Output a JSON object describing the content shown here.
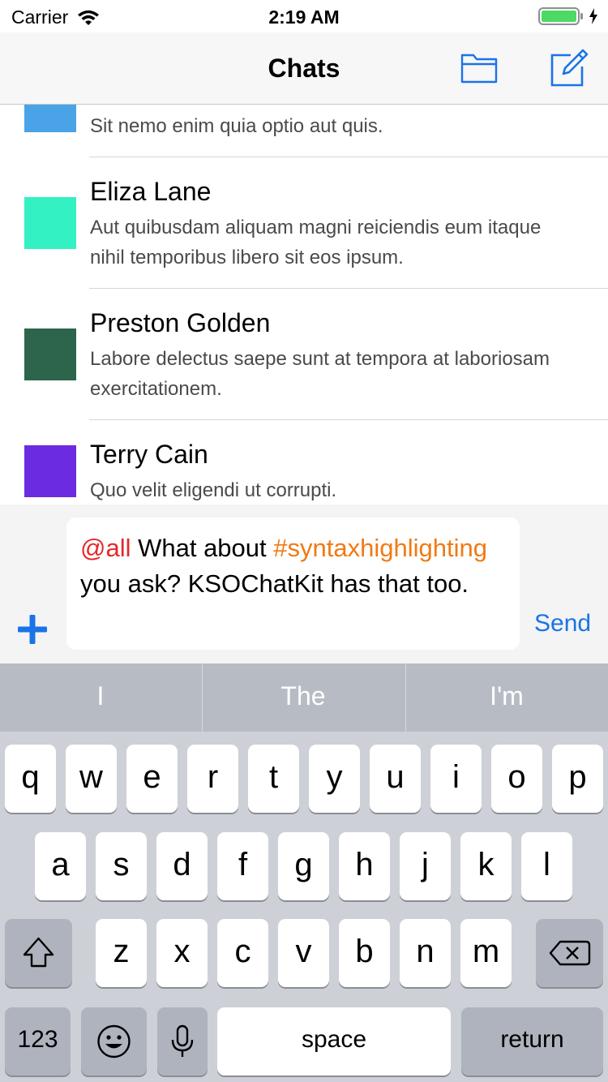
{
  "status_bar": {
    "carrier": "Carrier",
    "time": "2:19 AM"
  },
  "nav": {
    "title": "Chats",
    "accent_color": "#1a73e8"
  },
  "chats": [
    {
      "name": "",
      "message": "Sit nemo enim quia optio aut quis.",
      "avatar_color": "#4aa3e6"
    },
    {
      "name": "Eliza Lane",
      "message": "Aut quibusdam aliquam magni reiciendis eum itaque nihil temporibus libero sit eos ipsum.",
      "avatar_color": "#33f1c2"
    },
    {
      "name": "Preston Golden",
      "message": "Labore delectus saepe sunt at tempora at laboriosam exercitationem.",
      "avatar_color": "#2c654b"
    },
    {
      "name": "Terry Cain",
      "message": "Quo velit eligendi ut corrupti.",
      "avatar_color": "#6b2be0"
    }
  ],
  "composer": {
    "mention": "@all",
    "text_1": " What about ",
    "hashtag": "#syntaxhighlighting",
    "text_2": " you ask? KSOChatKit has that too.",
    "send_label": "Send",
    "mention_color": "#e8262b",
    "hashtag_color": "#f07a14"
  },
  "keyboard": {
    "suggestions": [
      "I",
      "The",
      "I'm"
    ],
    "row1": [
      "q",
      "w",
      "e",
      "r",
      "t",
      "y",
      "u",
      "i",
      "o",
      "p"
    ],
    "row2": [
      "a",
      "s",
      "d",
      "f",
      "g",
      "h",
      "j",
      "k",
      "l"
    ],
    "row3": [
      "z",
      "x",
      "c",
      "v",
      "b",
      "n",
      "m"
    ],
    "numbers_label": "123",
    "space_label": "space",
    "return_label": "return"
  }
}
